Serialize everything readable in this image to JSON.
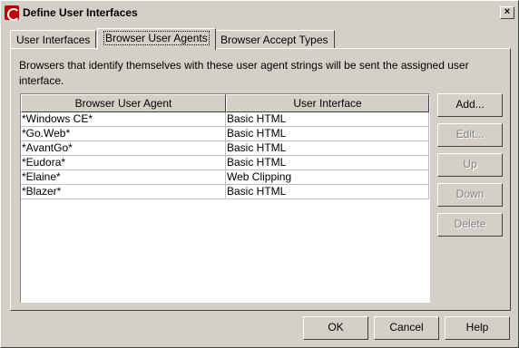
{
  "window": {
    "title": "Define User Interfaces",
    "close_label": "×"
  },
  "tabs": [
    {
      "label": "User Interfaces"
    },
    {
      "label": "Browser User Agents"
    },
    {
      "label": "Browser Accept Types"
    }
  ],
  "panel": {
    "description": "Browsers that identify themselves with these user agent strings will be sent the assigned user interface.",
    "table": {
      "headers": [
        "Browser User Agent",
        "User Interface"
      ],
      "rows": [
        [
          "*Windows CE*",
          "Basic HTML"
        ],
        [
          "*Go.Web*",
          "Basic HTML"
        ],
        [
          "*AvantGo*",
          "Basic HTML"
        ],
        [
          "*Eudora*",
          "Basic HTML"
        ],
        [
          "*Elaine*",
          "Web Clipping"
        ],
        [
          "*Blazer*",
          "Basic HTML"
        ]
      ]
    },
    "buttons": {
      "add": "Add...",
      "edit": "Edit...",
      "up": "Up",
      "down": "Down",
      "delete": "Delete"
    }
  },
  "footer": {
    "ok": "OK",
    "cancel": "Cancel",
    "help": "Help"
  }
}
